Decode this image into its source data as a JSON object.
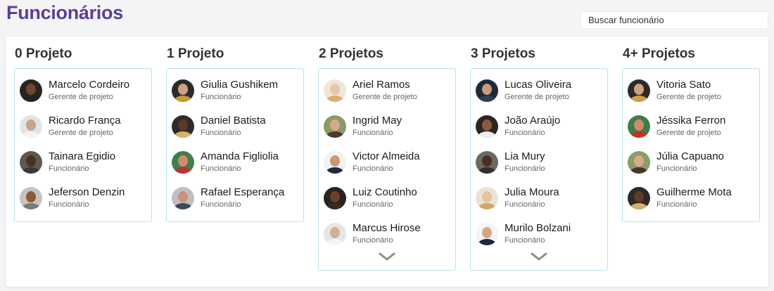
{
  "page_title": "Funcionários",
  "search": {
    "placeholder": "Buscar funcionário"
  },
  "columns": [
    {
      "title": "0 Projeto",
      "has_more": false,
      "employees": [
        {
          "name": "Marcelo Cordeiro",
          "role": "Gerente de projeto",
          "skin": "#6b4630",
          "bg": "#2a2320",
          "shirt": "#222222"
        },
        {
          "name": "Ricardo França",
          "role": "Gerente de projeto",
          "skin": "#c8a38a",
          "bg": "#e4e4e4",
          "shirt": "#f3f3f3"
        },
        {
          "name": "Tainara Egidio",
          "role": "Funcionário",
          "skin": "#4a2f22",
          "bg": "#5a5a50",
          "shirt": "#3a3a3a"
        },
        {
          "name": "Jeferson Denzin",
          "role": "Funcionário",
          "skin": "#8a5a3a",
          "bg": "#c9c3bd",
          "shirt": "#7a7a7a"
        }
      ]
    },
    {
      "title": "1 Projeto",
      "has_more": false,
      "employees": [
        {
          "name": "Giulia Gushikem",
          "role": "Funcionário",
          "skin": "#d0a080",
          "bg": "#2b2b2b",
          "shirt": "#c99a3a"
        },
        {
          "name": "Daniel Batista",
          "role": "Funcionário",
          "skin": "#5a3a28",
          "bg": "#2f2b28",
          "shirt": "#d9b26a"
        },
        {
          "name": "Amanda Figliolia",
          "role": "Funcionário",
          "skin": "#d08a70",
          "bg": "#3f7f4a",
          "shirt": "#c03030"
        },
        {
          "name": "Rafael Esperança",
          "role": "Funcionário",
          "skin": "#c8957a",
          "bg": "#bfbfbf",
          "shirt": "#3a4a5a"
        }
      ]
    },
    {
      "title": "2 Projetos",
      "has_more": true,
      "employees": [
        {
          "name": "Ariel Ramos",
          "role": "Gerente de projeto",
          "skin": "#e8c7a8",
          "bg": "#efe6da",
          "shirt": "#d8b070"
        },
        {
          "name": "Ingrid May",
          "role": "Funcionário",
          "skin": "#d7a88a",
          "bg": "#8a9a6a",
          "shirt": "#4a3a30"
        },
        {
          "name": "Victor Almeida",
          "role": "Funcionário",
          "skin": "#c89878",
          "bg": "#f2f2f2",
          "shirt": "#1f2a40"
        },
        {
          "name": "Luiz Coutinho",
          "role": "Funcionário",
          "skin": "#6a4028",
          "bg": "#2a2220",
          "shirt": "#3a2a22"
        },
        {
          "name": "Marcus Hirose",
          "role": "Funcionário",
          "skin": "#d4b096",
          "bg": "#e6e6e6",
          "shirt": "#f5f5f5"
        }
      ]
    },
    {
      "title": "3 Projetos",
      "has_more": true,
      "employees": [
        {
          "name": "Lucas Oliveira",
          "role": "Gerente de projeto",
          "skin": "#c89a80",
          "bg": "#1e2a3a",
          "shirt": "#2f3f55"
        },
        {
          "name": "João Araújo",
          "role": "Funcionário",
          "skin": "#8a5a40",
          "bg": "#2a2522",
          "shirt": "#eeeeee"
        },
        {
          "name": "Lia Mury",
          "role": "Funcionário",
          "skin": "#4a3024",
          "bg": "#6a6a60",
          "shirt": "#2f2f2f"
        },
        {
          "name": "Julia Moura",
          "role": "Funcionário",
          "skin": "#e6c2a0",
          "bg": "#ece2d4",
          "shirt": "#d2a868"
        },
        {
          "name": "Murilo Bolzani",
          "role": "Funcionário",
          "skin": "#d4a688",
          "bg": "#f4f4f4",
          "shirt": "#1c2740"
        }
      ]
    },
    {
      "title": "4+ Projetos",
      "has_more": false,
      "employees": [
        {
          "name": "Vitoria Sato",
          "role": "Gerente de projeto",
          "skin": "#cfa07e",
          "bg": "#2a2a2a",
          "shirt": "#c9a24a"
        },
        {
          "name": "Jéssika Ferron",
          "role": "Gerente de projeto",
          "skin": "#d28a6e",
          "bg": "#3e7e46",
          "shirt": "#c8302a"
        },
        {
          "name": "Júlia Capuano",
          "role": "Funcionário",
          "skin": "#d9aa8a",
          "bg": "#8a9c68",
          "shirt": "#463628"
        },
        {
          "name": "Guilherme Mota",
          "role": "Funcionário",
          "skin": "#5e3c28",
          "bg": "#2e2a26",
          "shirt": "#d6b06a"
        }
      ]
    }
  ],
  "colors": {
    "title": "#5b3f96",
    "card_border": "#b6e3ef",
    "chevron": "#8c8c8c"
  }
}
